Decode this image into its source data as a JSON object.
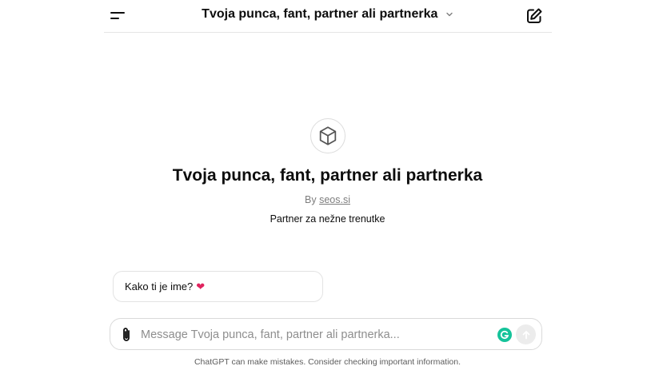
{
  "header": {
    "title": "Tvoja punca, fant, partner ali partnerka",
    "menu_icon": "menu-icon",
    "edit_icon": "new-chat-edit-icon"
  },
  "gpt": {
    "logo_icon": "cube-icon",
    "name": "Tvoja punca, fant, partner ali partnerka",
    "by_prefix": "By",
    "author": "seos.si",
    "description": "Partner za nežne trenutke"
  },
  "starters": [
    {
      "text": "Kako ti je ime?",
      "emoji": "❤"
    }
  ],
  "composer": {
    "placeholder": "Message Tvoja punca, fant, partner ali partnerka...",
    "value": "",
    "attach_icon": "paperclip-icon",
    "grammarly_icon": "grammarly-icon",
    "send_icon": "arrow-up-icon"
  },
  "footer": {
    "note": "ChatGPT can make mistakes. Consider checking important information."
  },
  "colors": {
    "text": "#0d0d0d",
    "muted": "#7d7d7d",
    "border": "#e3e3e3",
    "grammarly": "#15c39a",
    "heart": "#e0245e"
  }
}
